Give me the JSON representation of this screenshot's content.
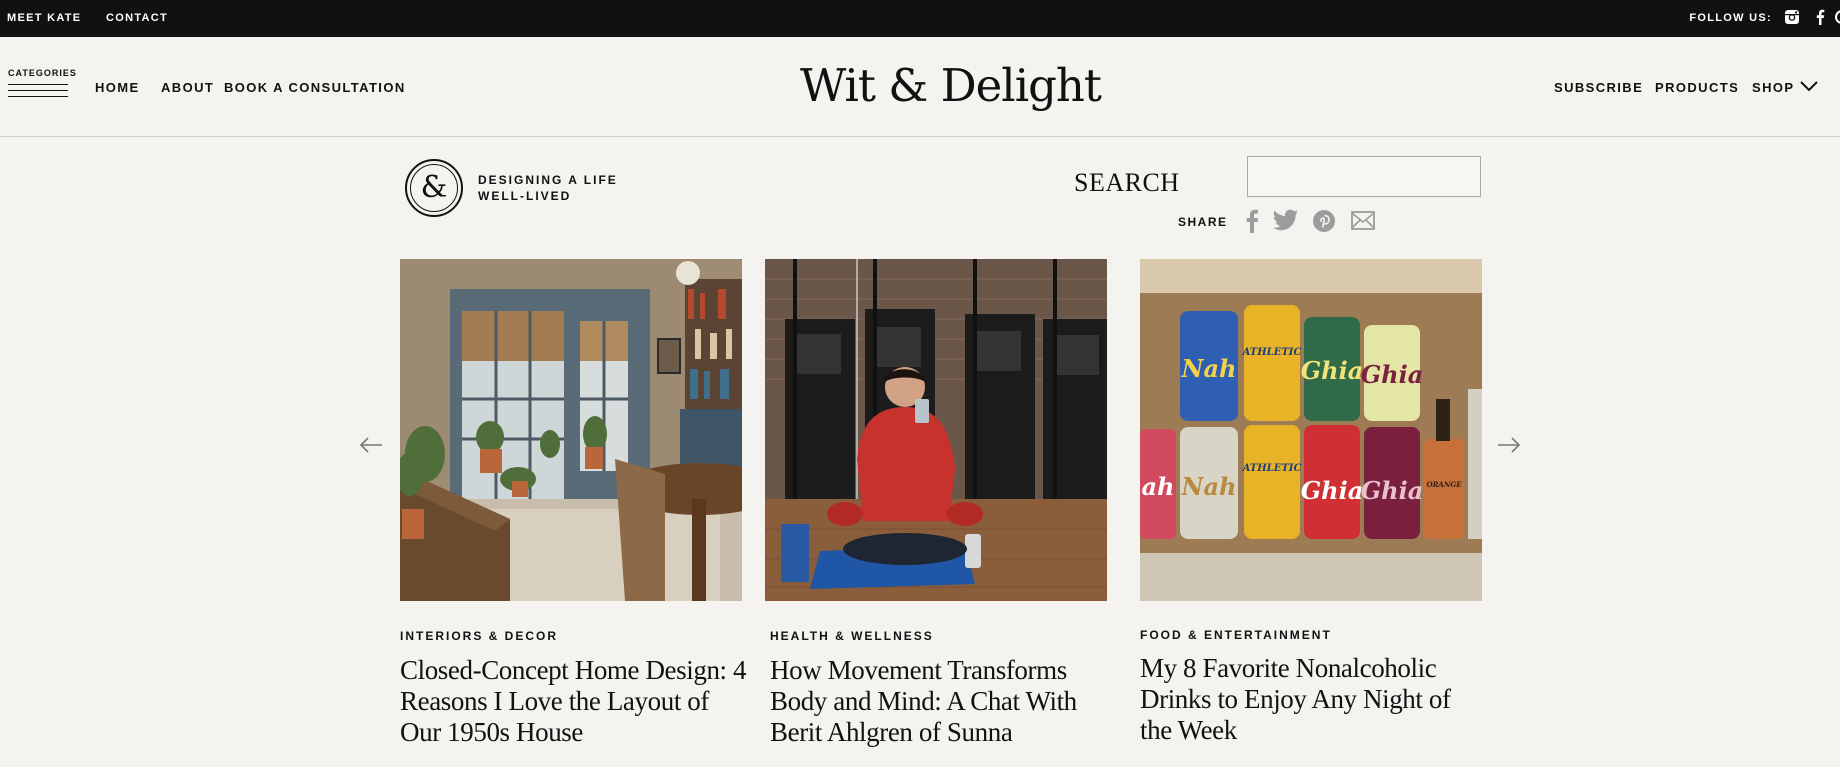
{
  "topbar": {
    "links": [
      "MEET KATE",
      "CONTACT"
    ],
    "follow_label": "FOLLOW US:",
    "icons": [
      "instagram-icon",
      "facebook-icon",
      "pinterest-icon"
    ]
  },
  "header": {
    "categories_label": "CATEGORIES",
    "nav_left": [
      "HOME",
      "ABOUT",
      "BOOK A CONSULTATION"
    ],
    "logo": "Wit & Delight",
    "nav_right": [
      "SUBSCRIBE",
      "PRODUCTS",
      "SHOP"
    ]
  },
  "badge": {
    "symbol": "&",
    "tagline_line1": "DESIGNING A LIFE",
    "tagline_line2": "WELL-LIVED"
  },
  "search": {
    "label": "SEARCH",
    "value": ""
  },
  "share": {
    "label": "SHARE",
    "icons": [
      "facebook-icon",
      "twitter-icon",
      "pinterest-icon",
      "email-icon"
    ]
  },
  "posts": [
    {
      "category": "INTERIORS & DECOR",
      "title": "Closed-Concept Home Design: 4 Reasons I Love the Layout of Our 1950s House"
    },
    {
      "category": "HEALTH & WELLNESS",
      "title": "How Movement Transforms Body and Mind: A Chat With Berit Ahlgren of Sunna"
    },
    {
      "category": "FOOD & ENTERTAINMENT",
      "title": "My 8 Favorite Nonalcoholic Drinks to Enjoy Any Night of the Week"
    }
  ],
  "can_labels": [
    "Nah",
    "ATHLETIC",
    "Ghia",
    "Ghia",
    "ah",
    "Nah",
    "ATHLETIC",
    "Ghia",
    "Ghia",
    "ORANGE"
  ],
  "colors": {
    "topbar_bg": "#111111",
    "page_bg": "#f4f3ef",
    "text": "#111111",
    "icon_gray": "#9c9c9c"
  }
}
